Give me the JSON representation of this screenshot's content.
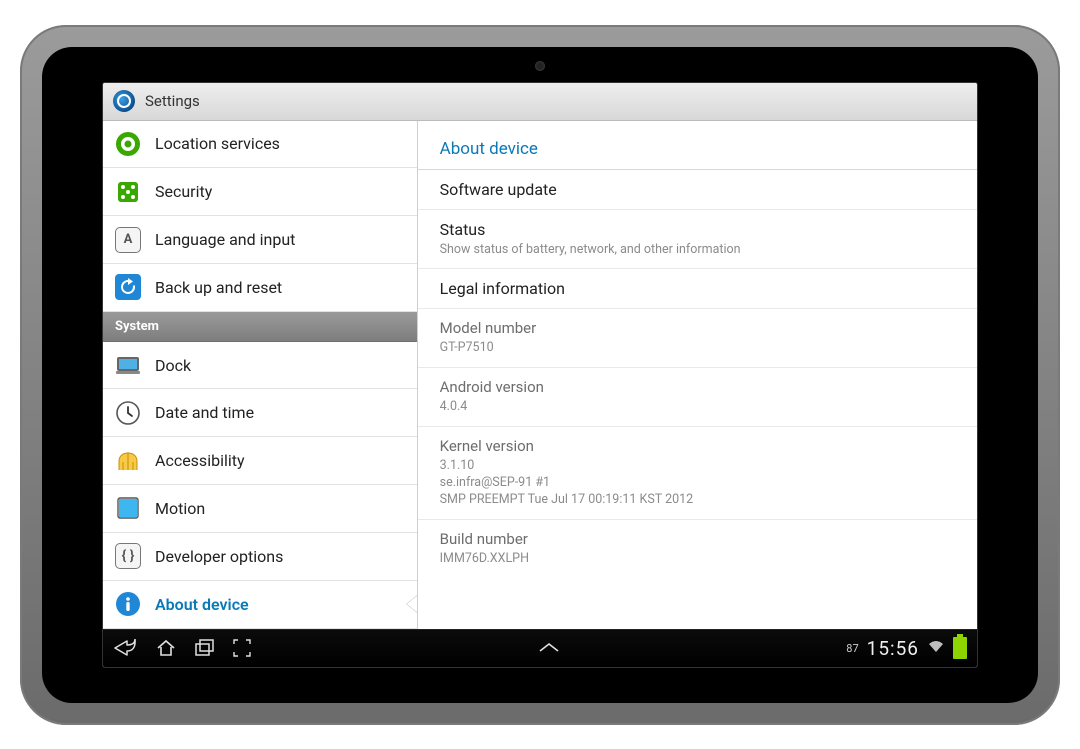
{
  "header": {
    "title": "Settings"
  },
  "sidebar": {
    "items": [
      {
        "label": "Location services"
      },
      {
        "label": "Security"
      },
      {
        "label": "Language and input"
      },
      {
        "label": "Back up and reset"
      }
    ],
    "systemHeader": "System",
    "systemItems": [
      {
        "label": "Dock"
      },
      {
        "label": "Date and time"
      },
      {
        "label": "Accessibility"
      },
      {
        "label": "Motion"
      },
      {
        "label": "Developer options"
      },
      {
        "label": "About device"
      }
    ]
  },
  "content": {
    "title": "About device",
    "softwareUpdate": "Software update",
    "status": {
      "title": "Status",
      "sub": "Show status of battery, network, and other information"
    },
    "legal": "Legal information",
    "model": {
      "title": "Model number",
      "value": "GT-P7510"
    },
    "android": {
      "title": "Android version",
      "value": "4.0.4"
    },
    "kernel": {
      "title": "Kernel version",
      "value": "3.1.10\nse.infra@SEP-91 #1\nSMP PREEMPT Tue Jul 17 00:19:11 KST 2012"
    },
    "build": {
      "title": "Build number",
      "value": "IMM76D.XXLPH"
    }
  },
  "navbar": {
    "batteryNum": "87",
    "time": "15:56"
  }
}
